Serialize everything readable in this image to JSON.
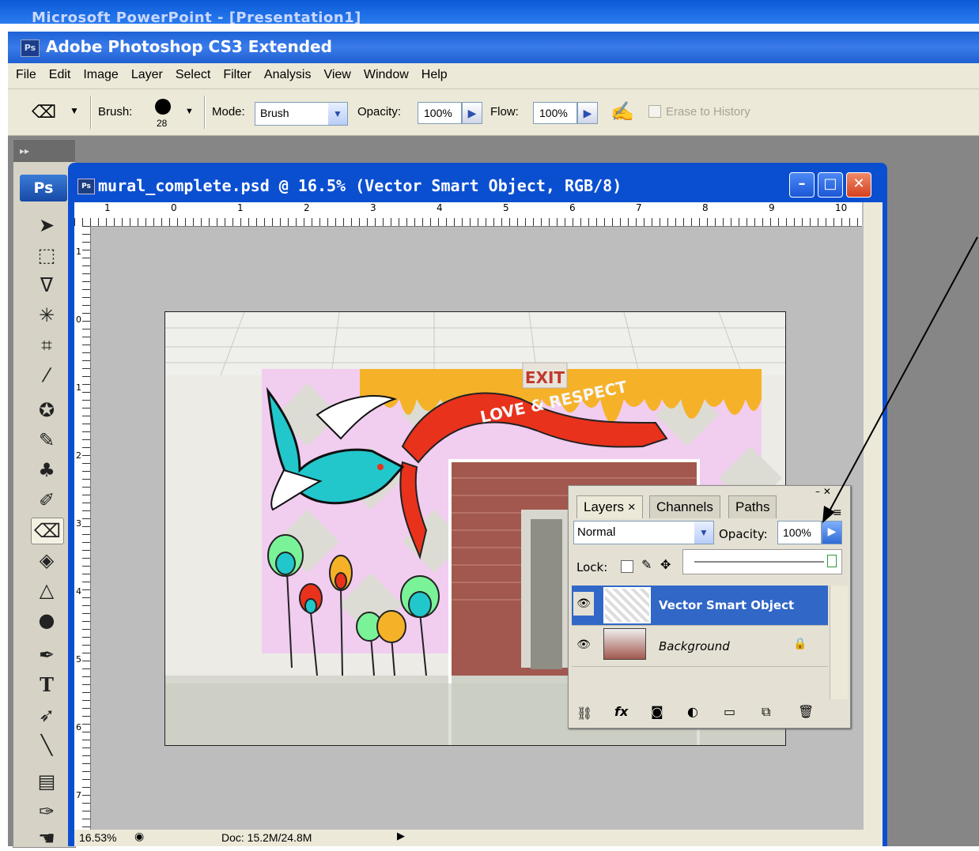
{
  "ppt": {
    "title": "Microsoft PowerPoint - [Presentation1]"
  },
  "app": {
    "title": "Adobe Photoshop CS3 Extended",
    "logo": "Ps"
  },
  "menu": [
    "File",
    "Edit",
    "Image",
    "Layer",
    "Select",
    "Filter",
    "Analysis",
    "View",
    "Window",
    "Help"
  ],
  "options": {
    "brush_label": "Brush:",
    "brush_size": "28",
    "mode_label": "Mode:",
    "mode_value": "Brush",
    "opacity_label": "Opacity:",
    "opacity_value": "100%",
    "flow_label": "Flow:",
    "flow_value": "100%",
    "erase_history_label": "Erase to History"
  },
  "toolbox": {
    "logo": "Ps"
  },
  "document": {
    "title": "mural_complete.psd @ 16.5% (Vector Smart Object, RGB/8)",
    "ruler_top": [
      "1",
      "0",
      "1",
      "2",
      "3",
      "4",
      "5",
      "6",
      "7",
      "8",
      "9",
      "10"
    ],
    "ruler_left": [
      "1",
      "0",
      "1",
      "2",
      "3",
      "4",
      "5",
      "6",
      "7"
    ]
  },
  "canvas": {
    "exit_sign": "EXIT",
    "banner_text": "LOVE & RESPECT",
    "colors": {
      "orange": "#f5b229",
      "pink": "#f1cdf0",
      "banner": "#e8321c",
      "bird": "#22c7cc"
    }
  },
  "layers_panel": {
    "tabs": [
      "Layers ×",
      "Channels",
      "Paths"
    ],
    "blend_mode": "Normal",
    "opacity_label": "Opacity:",
    "opacity_value": "100%",
    "lock_label": "Lock:",
    "layers": [
      {
        "name": "Vector Smart Object",
        "selected": true
      },
      {
        "name": "Background",
        "selected": false
      }
    ]
  },
  "status": {
    "zoom": "16.53%",
    "doc": "Doc: 15.2M/24.8M"
  }
}
